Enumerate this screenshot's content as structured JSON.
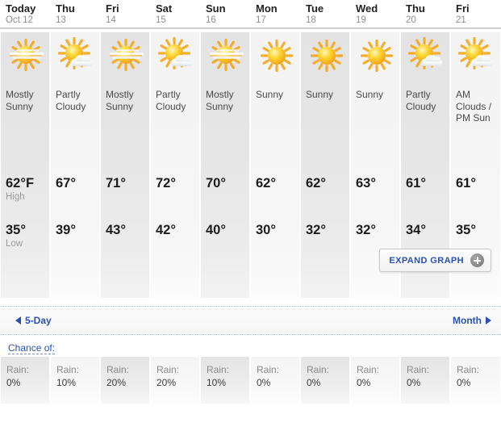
{
  "units": "F",
  "colors": {
    "link": "#2a52b5",
    "temp_text": "#1d1d1d",
    "label_gray": "#9a9a9a"
  },
  "columns": [
    {
      "day": "Today",
      "date": "Oct 12",
      "icon": "sun-behind-thin-cloud-icon",
      "condition": "Mostly Sunny",
      "high": "62°F",
      "high_label": "High",
      "low": "35°",
      "low_label": "Low",
      "rain_label": "Rain:",
      "rain": "0%"
    },
    {
      "day": "Thu",
      "date": "13",
      "icon": "sun-behind-cloud-icon",
      "condition": "Partly Cloudy",
      "high": "67°",
      "high_label": "",
      "low": "39°",
      "low_label": "",
      "rain_label": "Rain:",
      "rain": "10%"
    },
    {
      "day": "Fri",
      "date": "14",
      "icon": "sun-behind-thin-cloud-icon",
      "condition": "Mostly Sunny",
      "high": "71°",
      "high_label": "",
      "low": "43°",
      "low_label": "",
      "rain_label": "Rain:",
      "rain": "20%"
    },
    {
      "day": "Sat",
      "date": "15",
      "icon": "sun-behind-cloud-icon",
      "condition": "Partly Cloudy",
      "high": "72°",
      "high_label": "",
      "low": "42°",
      "low_label": "",
      "rain_label": "Rain:",
      "rain": "20%"
    },
    {
      "day": "Sun",
      "date": "16",
      "icon": "sun-behind-thin-cloud-icon",
      "condition": "Mostly Sunny",
      "high": "70°",
      "high_label": "",
      "low": "40°",
      "low_label": "",
      "rain_label": "Rain:",
      "rain": "10%"
    },
    {
      "day": "Mon",
      "date": "17",
      "icon": "sun-icon",
      "condition": "Sunny",
      "high": "62°",
      "high_label": "",
      "low": "30°",
      "low_label": "",
      "rain_label": "Rain:",
      "rain": "0%"
    },
    {
      "day": "Tue",
      "date": "18",
      "icon": "sun-icon",
      "condition": "Sunny",
      "high": "62°",
      "high_label": "",
      "low": "32°",
      "low_label": "",
      "rain_label": "Rain:",
      "rain": "0%"
    },
    {
      "day": "Wed",
      "date": "19",
      "icon": "sun-icon",
      "condition": "Sunny",
      "high": "63°",
      "high_label": "",
      "low": "32°",
      "low_label": "",
      "rain_label": "Rain:",
      "rain": "0%"
    },
    {
      "day": "Thu",
      "date": "20",
      "icon": "sun-behind-cloud-icon",
      "condition": "Partly Cloudy",
      "high": "61°",
      "high_label": "",
      "low": "34°",
      "low_label": "",
      "rain_label": "Rain:",
      "rain": "0%"
    },
    {
      "day": "Fri",
      "date": "21",
      "icon": "sun-behind-cloud-icon",
      "condition": "AM Clouds / PM Sun",
      "high": "61°",
      "high_label": "",
      "low": "35°",
      "low_label": "",
      "rain_label": "Rain:",
      "rain": "0%"
    }
  ],
  "expand_graph": {
    "label": "EXPAND GRAPH",
    "icon": "plus-circle-icon"
  },
  "navigation": {
    "prev_label": "5-Day",
    "prev_icon": "triangle-left-icon",
    "next_label": "Month",
    "next_icon": "triangle-right-icon"
  },
  "chance_of": {
    "label": "Chance of:"
  }
}
